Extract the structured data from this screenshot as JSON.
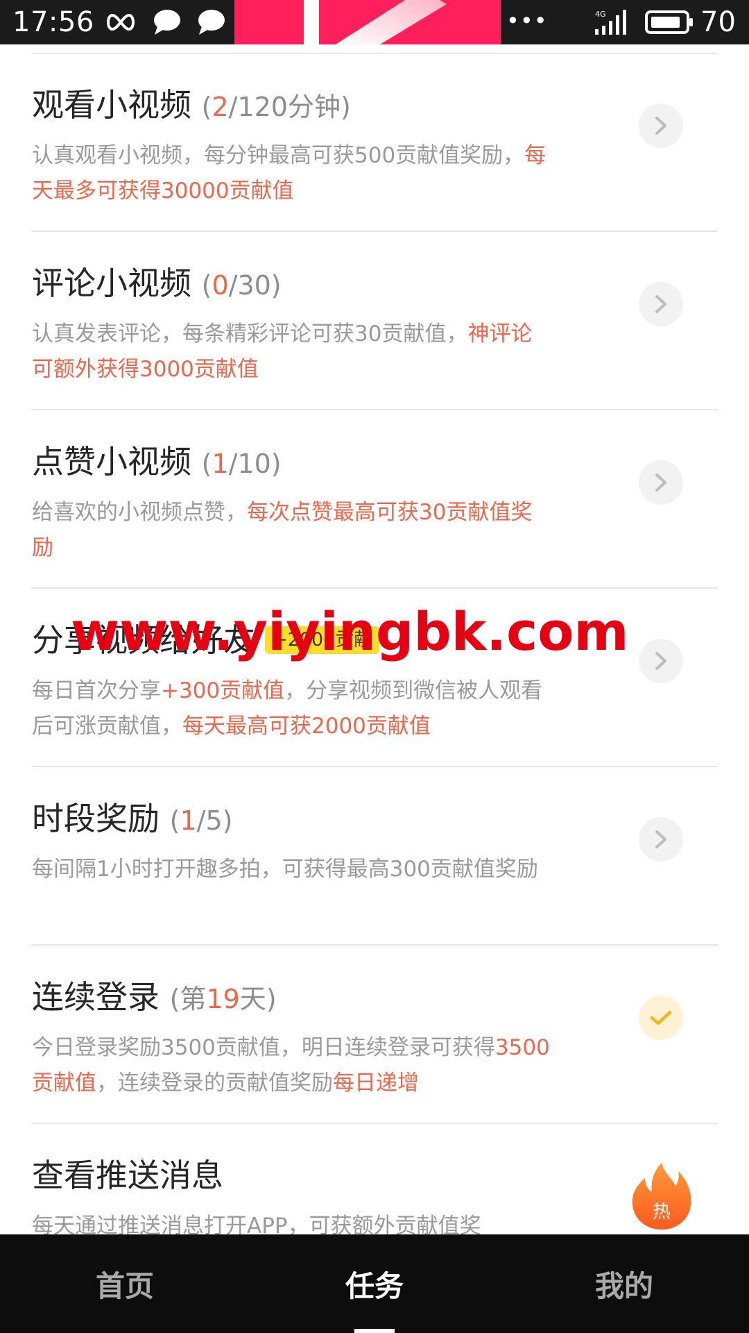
{
  "status_bar": {
    "time": "17:56",
    "battery": "70",
    "network": "4G",
    "icons": [
      "infinity-icon",
      "chat-bubble-icon",
      "chat-bubble-icon",
      "brand-logo",
      "more-icon",
      "signal-icon",
      "battery-icon"
    ]
  },
  "tasks": [
    {
      "title": "观看小视频",
      "count_open": "(",
      "count_current": "2",
      "count_rest": "/120分钟)",
      "desc_normal": "认真观看小视频，每分钟最高可获500贡献值奖励，",
      "desc_highlight": "每天最多可获得30000贡献值",
      "action": "chevron"
    },
    {
      "title": "评论小视频",
      "count_open": "(",
      "count_current": "0",
      "count_rest": "/30)",
      "desc_normal": "认真发表评论，每条精彩评论可获30贡献值，",
      "desc_highlight": "神评论可额外获得3000贡献值",
      "action": "chevron"
    },
    {
      "title": "点赞小视频",
      "count_open": "(",
      "count_current": "1",
      "count_rest": "/10)",
      "desc_normal": "给喜欢的小视频点赞，",
      "desc_highlight": "每次点赞最高可获30贡献值奖励",
      "action": "chevron"
    },
    {
      "title": "分享视频给好友",
      "badge": "+2000贡献",
      "desc_part1": "每日首次分享",
      "desc_part1_hl": "+300贡献值",
      "desc_part2": "，分享视频到微信被人观看后可涨贡献值，",
      "desc_part2_hl": "每天最高可获2000贡献值",
      "action": "chevron"
    },
    {
      "title": "时段奖励",
      "count_open": "(",
      "count_current": "1",
      "count_rest": "/5)",
      "desc_normal": "每间隔1小时打开趣多拍，可获得最高300贡献值奖励",
      "action": "chevron"
    },
    {
      "title": "连续登录",
      "count_open": "(第",
      "count_current": "19",
      "count_rest": "天)",
      "desc_normal": "今日登录奖励3500贡献值，明日连续登录可获得",
      "desc_highlight": "3500贡献值",
      "desc_normal2": "，连续登录的贡献值奖励",
      "desc_highlight2": "每日递增",
      "action": "check"
    },
    {
      "title": "查看推送消息",
      "desc_normal": "每天通过推送消息打开APP，可获额外贡献值奖",
      "action": "hot",
      "hot_label": "热"
    }
  ],
  "watermark": "www.yiyingbk.com",
  "bottom_nav": {
    "items": [
      {
        "label": "首页",
        "active": false
      },
      {
        "label": "任务",
        "active": true
      },
      {
        "label": "我的",
        "active": false
      }
    ]
  },
  "colors": {
    "highlight": "#f0664a",
    "badge": "#ffdd2d",
    "watermark": "#e50012",
    "nav_bg": "#0d0d0d",
    "status_bg": "#1b1b1b"
  }
}
